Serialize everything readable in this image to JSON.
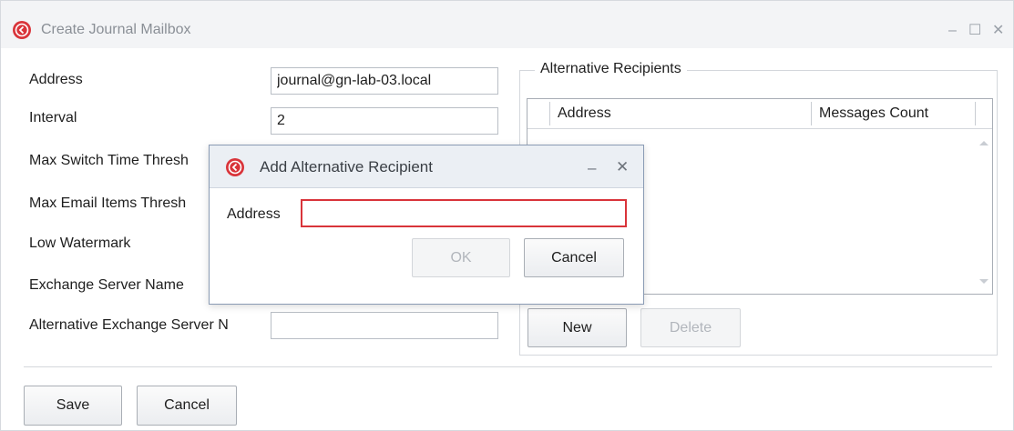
{
  "window": {
    "title": "Create Journal Mailbox",
    "minimize": "–",
    "maximize": "☐",
    "close": "✕"
  },
  "form": {
    "address_label": "Address",
    "address_value": "journal@gn-lab-03.local",
    "interval_label": "Interval",
    "interval_value": "2",
    "max_switch_label": "Max Switch Time Thresh",
    "max_email_label": "Max Email Items Thresh",
    "low_watermark_label": "Low Watermark",
    "exchange_server_label": "Exchange Server Name",
    "alt_exchange_label": "Alternative Exchange Server N",
    "alt_exchange_value": ""
  },
  "recipients": {
    "group_title": "Alternative Recipients",
    "columns": [
      "Address",
      "Messages Count"
    ],
    "rows": [],
    "new_label": "New",
    "delete_label": "Delete"
  },
  "footer": {
    "save_label": "Save",
    "cancel_label": "Cancel"
  },
  "dialog": {
    "title": "Add Alternative Recipient",
    "minimize": "–",
    "close": "✕",
    "address_label": "Address",
    "address_value": "",
    "ok_label": "OK",
    "cancel_label": "Cancel"
  },
  "colors": {
    "app_icon": "#d9343a",
    "invalid_border": "#d9343a",
    "dialog_border": "#8a9bb4"
  }
}
